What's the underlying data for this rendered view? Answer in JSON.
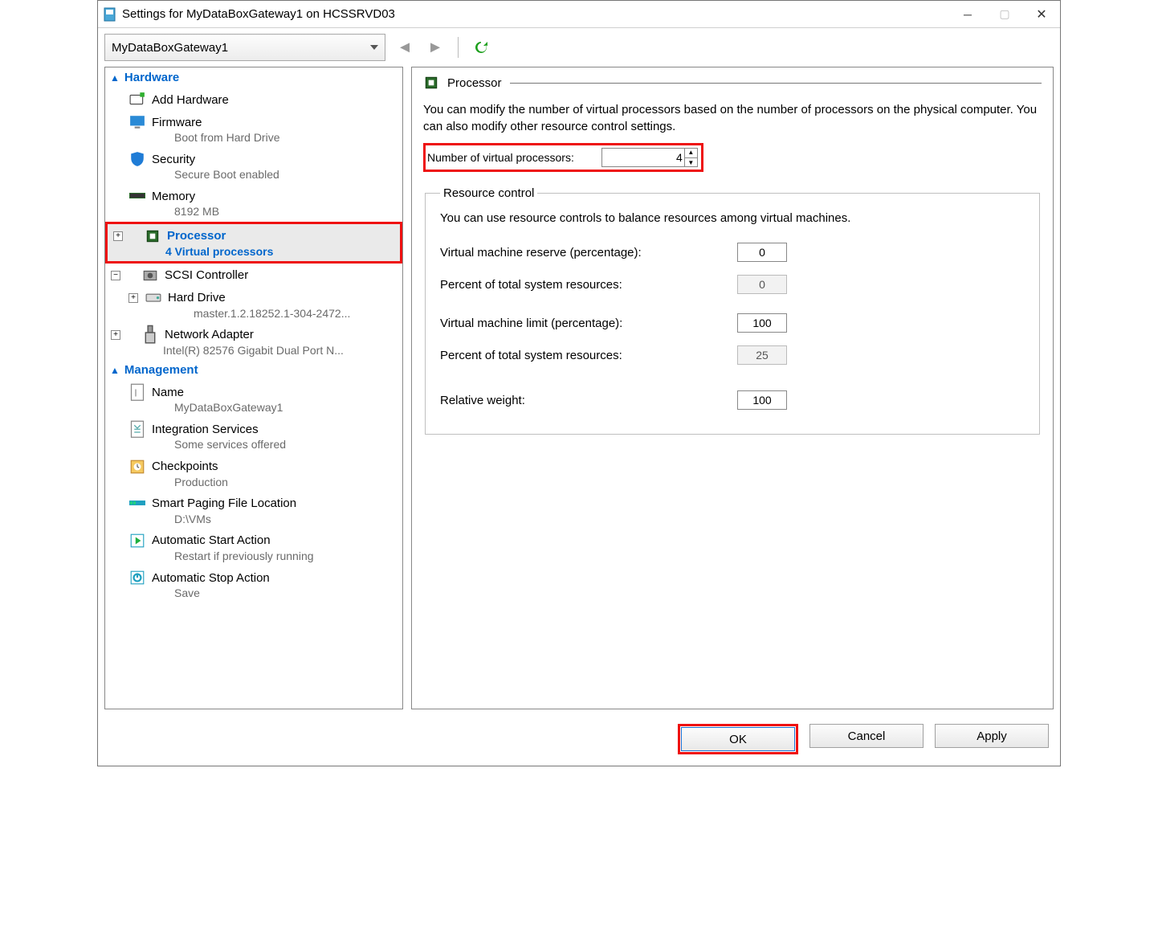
{
  "title": "Settings for MyDataBoxGateway1 on HCSSRVD03",
  "vm_selector": "MyDataBoxGateway1",
  "sections": {
    "hardware": "Hardware",
    "management": "Management"
  },
  "tree": {
    "add_hardware": "Add Hardware",
    "firmware": {
      "label": "Firmware",
      "sub": "Boot from Hard Drive"
    },
    "security": {
      "label": "Security",
      "sub": "Secure Boot enabled"
    },
    "memory": {
      "label": "Memory",
      "sub": "8192 MB"
    },
    "processor": {
      "label": "Processor",
      "sub": "4 Virtual processors"
    },
    "scsi": {
      "label": "SCSI Controller"
    },
    "harddrive": {
      "label": "Hard Drive",
      "sub": "master.1.2.18252.1-304-2472..."
    },
    "netadapter": {
      "label": "Network Adapter",
      "sub": "Intel(R) 82576 Gigabit Dual Port N..."
    },
    "name": {
      "label": "Name",
      "sub": "MyDataBoxGateway1"
    },
    "integration": {
      "label": "Integration Services",
      "sub": "Some services offered"
    },
    "checkpoints": {
      "label": "Checkpoints",
      "sub": "Production"
    },
    "smartpaging": {
      "label": "Smart Paging File Location",
      "sub": "D:\\VMs"
    },
    "autostart": {
      "label": "Automatic Start Action",
      "sub": "Restart if previously running"
    },
    "autostop": {
      "label": "Automatic Stop Action",
      "sub": "Save"
    }
  },
  "panel": {
    "title": "Processor",
    "desc": "You can modify the number of virtual processors based on the number of processors on the physical computer. You can also modify other resource control settings.",
    "vp_label": "Number of virtual processors:",
    "vp_value": "4",
    "resctl_legend": "Resource control",
    "resctl_desc": "You can use resource controls to balance resources among virtual machines.",
    "reserve_label": "Virtual machine reserve (percentage):",
    "reserve_value": "0",
    "reserve_pct_label": "Percent of total system resources:",
    "reserve_pct_value": "0",
    "limit_label": "Virtual machine limit (percentage):",
    "limit_value": "100",
    "limit_pct_label": "Percent of total system resources:",
    "limit_pct_value": "25",
    "weight_label": "Relative weight:",
    "weight_value": "100"
  },
  "footer": {
    "ok": "OK",
    "cancel": "Cancel",
    "apply": "Apply"
  }
}
